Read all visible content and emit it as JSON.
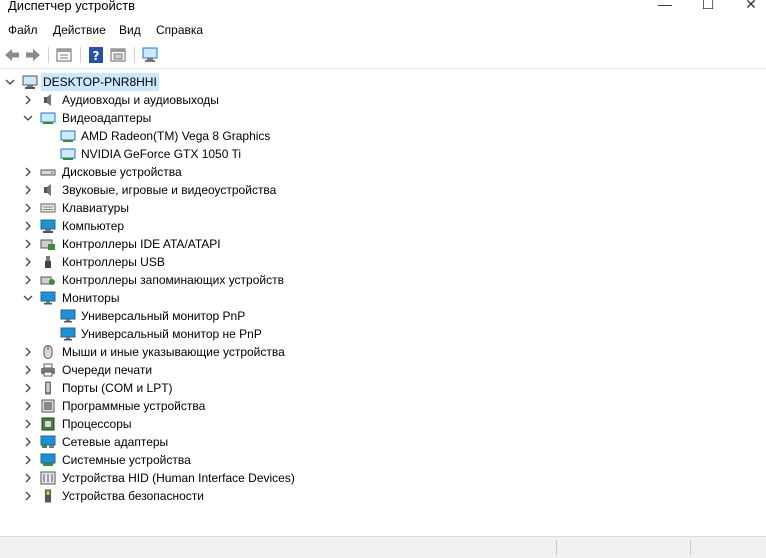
{
  "window": {
    "title": "Диспетчер устройств",
    "minimize": "—",
    "maximize": "☐",
    "close": "✕"
  },
  "menu": [
    "Файл",
    "Действие",
    "Вид",
    "Справка"
  ],
  "toolbar": [
    "back-arrow-icon",
    "forward-arrow-icon",
    "properties-icon",
    "help-icon",
    "update-driver-icon",
    "scan-hardware-icon"
  ],
  "tree": {
    "root": "DESKTOP-PNR8HHI",
    "categories": [
      {
        "label": "Аудиовходы и аудиовыходы",
        "icon": "speaker-icon",
        "expanded": false
      },
      {
        "label": "Видеоадаптеры",
        "icon": "display-adapter-icon",
        "expanded": true,
        "children": [
          {
            "label": "AMD Radeon(TM) Vega 8 Graphics",
            "icon": "display-adapter-icon"
          },
          {
            "label": "NVIDIA GeForce GTX 1050 Ti",
            "icon": "display-adapter-icon"
          }
        ]
      },
      {
        "label": "Дисковые устройства",
        "icon": "disk-drive-icon",
        "expanded": false
      },
      {
        "label": "Звуковые, игровые и видеоустройства",
        "icon": "speaker-icon",
        "expanded": false
      },
      {
        "label": "Клавиатуры",
        "icon": "keyboard-icon",
        "expanded": false
      },
      {
        "label": "Компьютер",
        "icon": "computer-icon",
        "expanded": false
      },
      {
        "label": "Контроллеры IDE ATA/ATAPI",
        "icon": "ide-controller-icon",
        "expanded": false
      },
      {
        "label": "Контроллеры USB",
        "icon": "usb-icon",
        "expanded": false
      },
      {
        "label": "Контроллеры запоминающих устройств",
        "icon": "storage-controller-icon",
        "expanded": false
      },
      {
        "label": "Мониторы",
        "icon": "monitor-icon",
        "expanded": true,
        "children": [
          {
            "label": "Универсальный монитор PnP",
            "icon": "monitor-icon"
          },
          {
            "label": "Универсальный монитор не PnP",
            "icon": "monitor-icon"
          }
        ]
      },
      {
        "label": "Мыши и иные указывающие устройства",
        "icon": "mouse-icon",
        "expanded": false
      },
      {
        "label": "Очереди печати",
        "icon": "printer-icon",
        "expanded": false
      },
      {
        "label": "Порты (COM и LPT)",
        "icon": "port-icon",
        "expanded": false
      },
      {
        "label": "Программные устройства",
        "icon": "software-device-icon",
        "expanded": false
      },
      {
        "label": "Процессоры",
        "icon": "processor-icon",
        "expanded": false
      },
      {
        "label": "Сетевые адаптеры",
        "icon": "network-adapter-icon",
        "expanded": false
      },
      {
        "label": "Системные устройства",
        "icon": "system-device-icon",
        "expanded": false
      },
      {
        "label": "Устройства HID (Human Interface Devices)",
        "icon": "hid-icon",
        "expanded": false
      },
      {
        "label": "Устройства безопасности",
        "icon": "security-device-icon",
        "expanded": false
      }
    ]
  },
  "colors": {
    "selection": "#cce8ff",
    "monitor_blue": "#1e90d6",
    "icon_gray": "#555555"
  }
}
